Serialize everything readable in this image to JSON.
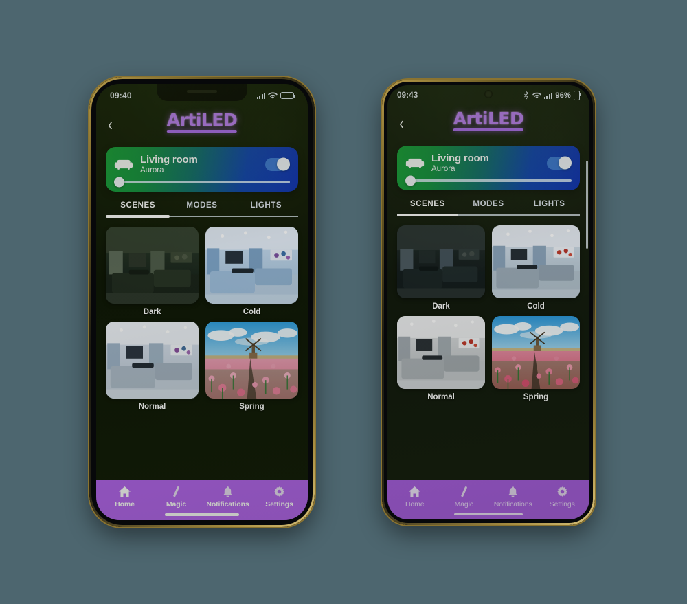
{
  "page": {
    "background_color": "#4d666f",
    "description": "Two smartphones side by side showing the ArtiLED smart lighting app scenes screen"
  },
  "phones": [
    {
      "id": "left",
      "platform": "ios",
      "status_bar": {
        "time": "09:40",
        "icons": [
          "signal-icon",
          "wifi-icon",
          "battery-icon"
        ]
      },
      "header": {
        "back_icon": "chevron-left-icon",
        "logo_text": "ArtiLED",
        "logo_color": "#c07dfb"
      },
      "room_card": {
        "icon": "sofa-icon",
        "name": "Living room",
        "effect": "Aurora",
        "toggle_on": true,
        "brightness_percent": 0,
        "gradient_from": "#14a03a",
        "gradient_to": "#0b2fb4"
      },
      "tabs": [
        {
          "label": "SCENES",
          "active": true
        },
        {
          "label": "MODES",
          "active": false
        },
        {
          "label": "LIGHTS",
          "active": false
        }
      ],
      "scenes": [
        {
          "label": "Dark",
          "thumb": "living-room-dark"
        },
        {
          "label": "Cold",
          "thumb": "living-room-cold"
        },
        {
          "label": "Normal",
          "thumb": "living-room-normal"
        },
        {
          "label": "Spring",
          "thumb": "tulip-field-windmill"
        }
      ],
      "bottom_nav": {
        "background_color": "#b463f0",
        "items": [
          {
            "label": "Home",
            "icon": "home-icon",
            "active": true
          },
          {
            "label": "Magic",
            "icon": "wand-icon",
            "active": false
          },
          {
            "label": "Notifications",
            "icon": "bell-icon",
            "active": false
          },
          {
            "label": "Settings",
            "icon": "gear-icon",
            "active": false
          }
        ]
      }
    },
    {
      "id": "right",
      "platform": "android",
      "status_bar": {
        "time": "09:43",
        "battery_percent": "96%",
        "icons": [
          "bluetooth-icon",
          "wifi-icon",
          "signal-icon",
          "battery-icon"
        ]
      },
      "header": {
        "back_icon": "chevron-left-icon",
        "logo_text": "ArtiLED",
        "logo_color": "#c07dfb"
      },
      "room_card": {
        "icon": "sofa-icon",
        "name": "Living room",
        "effect": "Aurora",
        "toggle_on": true,
        "brightness_percent": 0,
        "gradient_from": "#14a03a",
        "gradient_to": "#0b2fb4"
      },
      "tabs": [
        {
          "label": "SCENES",
          "active": true
        },
        {
          "label": "MODES",
          "active": false
        },
        {
          "label": "LIGHTS",
          "active": false
        }
      ],
      "scenes": [
        {
          "label": "Dark",
          "thumb": "living-room-dark"
        },
        {
          "label": "Cold",
          "thumb": "living-room-cold"
        },
        {
          "label": "Normal",
          "thumb": "living-room-normal"
        },
        {
          "label": "Spring",
          "thumb": "tulip-field-windmill"
        }
      ],
      "bottom_nav": {
        "background_color": "#a95ce4",
        "items": [
          {
            "label": "Home",
            "icon": "home-icon",
            "active": true
          },
          {
            "label": "Magic",
            "icon": "wand-icon",
            "active": false
          },
          {
            "label": "Notifications",
            "icon": "bell-icon",
            "active": false
          },
          {
            "label": "Settings",
            "icon": "gear-icon",
            "active": false
          }
        ]
      }
    }
  ]
}
